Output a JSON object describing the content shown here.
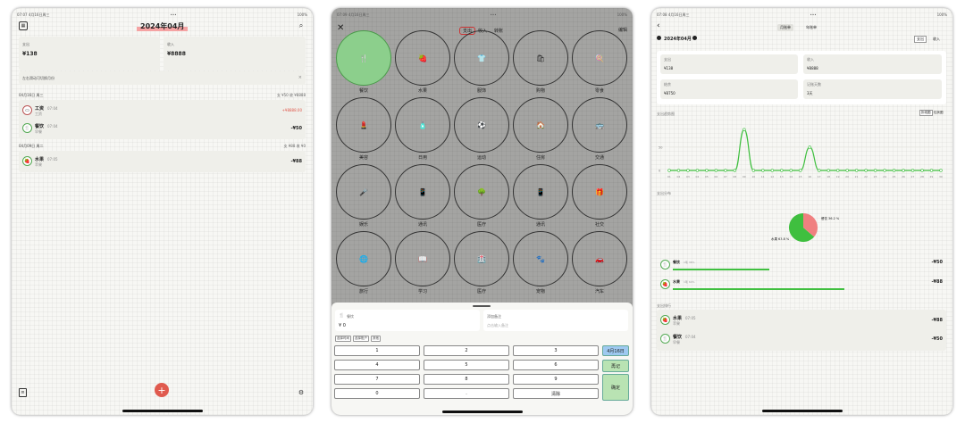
{
  "screen1": {
    "status_time": "07:07",
    "status_date": "4月16日周三",
    "status_battery": "100%",
    "month_title": "2024年04月",
    "expense_label": "支出",
    "expense_value": "¥138",
    "income_label": "收入",
    "income_value": "¥8888",
    "tip": "左右滑动可切换月份",
    "days": [
      {
        "date": "04月16日 周三",
        "summary": "支 ¥50  收 ¥8888",
        "items": [
          {
            "name": "工资",
            "time": "07:04",
            "sub": "工资",
            "amount": "+¥8888.00",
            "icon": "wallet-icon",
            "color": "#e05a4e"
          },
          {
            "name": "餐饮",
            "time": "07:04",
            "sub": "早餐",
            "amount": "-¥50",
            "icon": "fork-knife-icon",
            "color": "#222"
          }
        ]
      },
      {
        "date": "04月09日 周二",
        "summary": "支 ¥88  收 ¥0",
        "items": [
          {
            "name": "水果",
            "time": "07:05",
            "sub": "苹果",
            "amount": "-¥88",
            "icon": "strawberry-icon",
            "color": "#222"
          }
        ]
      }
    ],
    "fab": "+"
  },
  "screen2": {
    "status_time": "07:09",
    "status_date": "4月16日周三",
    "status_battery": "100%",
    "tabs": [
      "支出",
      "收入",
      "转账"
    ],
    "edit": "编辑",
    "categories": [
      {
        "label": "餐饮",
        "glyph": "🍴"
      },
      {
        "label": "水果",
        "glyph": "🍓"
      },
      {
        "label": "服饰",
        "glyph": "👕"
      },
      {
        "label": "购物",
        "glyph": "🛍"
      },
      {
        "label": "零食",
        "glyph": "🍭"
      },
      {
        "label": "美容",
        "glyph": "💄"
      },
      {
        "label": "日用",
        "glyph": "🧴"
      },
      {
        "label": "运动",
        "glyph": "⚽"
      },
      {
        "label": "住房",
        "glyph": "🏠"
      },
      {
        "label": "交通",
        "glyph": "🚌"
      },
      {
        "label": "娱乐",
        "glyph": "🎤"
      },
      {
        "label": "通讯",
        "glyph": "📱"
      },
      {
        "label": "医疗",
        "glyph": "🌳"
      },
      {
        "label": "通讯",
        "glyph": "📱"
      },
      {
        "label": "社交",
        "glyph": "🎁"
      },
      {
        "label": "旅行",
        "glyph": "🌐"
      },
      {
        "label": "学习",
        "glyph": "📖"
      },
      {
        "label": "医疗",
        "glyph": "🏥"
      },
      {
        "label": "宠物",
        "glyph": "🐾"
      },
      {
        "label": "汽车",
        "glyph": "🚗"
      }
    ],
    "selected_cat": "餐饮",
    "amount": "¥ 0",
    "note_label": "添加备注",
    "note_placeholder": "点击输入备注",
    "chips": [
      "选择时间",
      "选择账户",
      "其他"
    ],
    "keys": [
      [
        "1",
        "2",
        "3",
        "4月16日"
      ],
      [
        "4",
        "5",
        "6",
        "再记"
      ],
      [
        "7",
        "8",
        "9",
        "确定"
      ],
      [
        "0",
        ".",
        "清除",
        ""
      ]
    ]
  },
  "screen3": {
    "status_time": "07:08",
    "status_date": "4月16日周三",
    "status_battery": "100%",
    "tabs": [
      "月账单",
      "年账单"
    ],
    "month": "2024年04月",
    "type_tabs": [
      "支出",
      "收入"
    ],
    "stats": [
      {
        "label": "支出",
        "value": "¥138"
      },
      {
        "label": "收入",
        "value": "¥8888"
      },
      {
        "label": "结余",
        "value": "¥8750"
      },
      {
        "label": "记账天数",
        "value": "3天"
      }
    ],
    "trend_title": "支出趋势图",
    "trend_toggle": [
      "折线图",
      "柱状图"
    ],
    "chart_data": {
      "type": "line",
      "x": [
        "01",
        "02",
        "03",
        "04",
        "05",
        "06",
        "07",
        "08",
        "09",
        "10",
        "11",
        "12",
        "13",
        "14",
        "15",
        "16",
        "17",
        "18",
        "19",
        "20",
        "21",
        "22",
        "23",
        "24",
        "25",
        "26",
        "27",
        "28",
        "29",
        "30"
      ],
      "values": [
        0,
        0,
        0,
        0,
        0,
        0,
        0,
        0,
        88,
        0,
        0,
        0,
        0,
        0,
        0,
        50,
        0,
        0,
        0,
        0,
        0,
        0,
        0,
        0,
        0,
        0,
        0,
        0,
        0,
        0
      ],
      "yticks": [
        "50",
        "0"
      ],
      "ylim": [
        0,
        100
      ],
      "color": "#3fbf3f"
    },
    "share_title": "支出分布",
    "pie": [
      {
        "name": "水果",
        "pct": "63.8 %",
        "value": 63.8,
        "color": "#3fbf3f"
      },
      {
        "name": "餐饮",
        "pct": "36.2 %",
        "value": 36.2,
        "color": "#f08080"
      }
    ],
    "ranking": [
      {
        "name": "餐饮",
        "pct": "1笔 36%",
        "amount": "-¥50",
        "icon": "fork-knife-icon",
        "fill": 0.36
      },
      {
        "name": "水果",
        "pct": "1笔 64%",
        "amount": "-¥88",
        "icon": "strawberry-icon",
        "fill": 0.64
      }
    ],
    "rank_title": "支出排行",
    "rank_list": [
      {
        "name": "水果",
        "time": "07:05",
        "sub": "苹果",
        "amount": "-¥88",
        "icon": "strawberry-icon"
      },
      {
        "name": "餐饮",
        "time": "07:04",
        "sub": "早餐",
        "amount": "-¥50",
        "icon": "fork-knife-icon"
      }
    ]
  }
}
